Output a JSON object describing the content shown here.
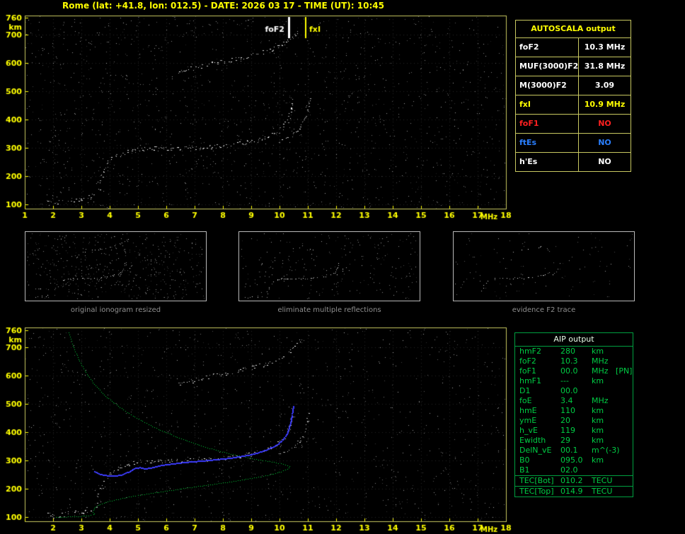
{
  "title": "Rome (lat: +41.8, lon: 012.5) - DATE: 2026 03 17 - TIME (UT): 10:45",
  "colors": {
    "accent_yellow": "#ffff00",
    "frame_yellow": "#c8c860",
    "green": "#00cc44",
    "blue": "#3c3cff",
    "red": "#ff2020",
    "table_blue": "#2a7fff",
    "white": "#ffffff",
    "caption_gray": "#8f8f8f"
  },
  "autoscala": {
    "header": "AUTOSCALA output",
    "rows": [
      {
        "param": "foF2",
        "value": "10.3 MHz",
        "color": "#ffffff"
      },
      {
        "param": "MUF(3000)F2",
        "value": "31.8 MHz",
        "color": "#ffffff"
      },
      {
        "param": "M(3000)F2",
        "value": "3.09",
        "color": "#ffffff"
      },
      {
        "param": "fxI",
        "value": "10.9 MHz",
        "color": "#ffff00"
      },
      {
        "param": "foF1",
        "value": "NO",
        "color": "#ff2020"
      },
      {
        "param": "ftEs",
        "value": "NO",
        "color": "#2a7fff"
      },
      {
        "param": "h'Es",
        "value": "NO",
        "color": "#ffffff"
      }
    ]
  },
  "thumbnails": [
    {
      "caption": "original ionogram resized"
    },
    {
      "caption": "eliminate multiple reflections"
    },
    {
      "caption": "evidence F2 trace"
    }
  ],
  "aip": {
    "header": "AIP output",
    "rows": [
      {
        "param": "hmF2",
        "value": "280",
        "unit": "km"
      },
      {
        "param": "foF2",
        "value": "10.3",
        "unit": "MHz"
      },
      {
        "param": "foF1",
        "value": "00.0",
        "unit": "MHz   [PN]"
      },
      {
        "param": "hmF1",
        "value": "---",
        "unit": "km"
      },
      {
        "param": "D1",
        "value": "00.0",
        "unit": ""
      },
      {
        "param": "foE",
        "value": "3.4",
        "unit": "MHz"
      },
      {
        "param": "hmE",
        "value": "110",
        "unit": "km"
      },
      {
        "param": "ymE",
        "value": "20",
        "unit": "km"
      },
      {
        "param": "h_vE",
        "value": "119",
        "unit": "km"
      },
      {
        "param": "Ewidth",
        "value": "29",
        "unit": "km"
      },
      {
        "param": "DelN_vE",
        "value": "00.1",
        "unit": "m^(-3)"
      },
      {
        "param": "B0",
        "value": "095.0",
        "unit": "km"
      },
      {
        "param": "B1",
        "value": "02.0",
        "unit": ""
      },
      {
        "param": "TEC[Bot]",
        "value": "010.2",
        "unit": "TECU"
      },
      {
        "param": "TEC[Top]",
        "value": "014.9",
        "unit": "TECU"
      }
    ]
  },
  "chart_data": {
    "type": "scatter",
    "title": "Autoscaled ionogram, Rome, 2026-03-17 10:45 UT",
    "xlabel": "MHz",
    "ylabel": "km",
    "xlim": [
      1,
      18
    ],
    "ylim": [
      85,
      770
    ],
    "y_ticks": [
      760,
      700,
      600,
      500,
      400,
      300,
      200,
      100
    ],
    "x_end_label": "18",
    "frame_color": "#c8c860",
    "tick_color": "#ffff00",
    "grid": "dotted",
    "plots": [
      {
        "id": "top",
        "x_tick_labels": [
          "1",
          "2",
          "3",
          "4",
          "5",
          "6",
          "7",
          "8",
          "9",
          "10",
          "11",
          "12",
          "13",
          "14",
          "15",
          "16",
          "17"
        ],
        "markers": [
          {
            "x": 10.3,
            "label": "foF2",
            "color": "#ffffff",
            "side": "left",
            "w": 3
          },
          {
            "x": 10.9,
            "label": "fxI",
            "color": "#ffff00",
            "side": "right",
            "w": 2
          }
        ]
      },
      {
        "id": "bottom",
        "x_tick_labels": [
          "",
          "2",
          "3",
          "4",
          "5",
          "6",
          "7",
          "8",
          "9",
          "10",
          "11",
          "12",
          "13",
          "14",
          "15",
          "16",
          "17"
        ],
        "markers": []
      }
    ],
    "traces": {
      "f2_ordinary": [
        [
          3.55,
          170
        ],
        [
          3.7,
          195
        ],
        [
          3.8,
          220
        ],
        [
          3.95,
          245
        ],
        [
          4.15,
          264
        ],
        [
          4.4,
          278
        ],
        [
          4.7,
          289
        ],
        [
          5.0,
          295
        ],
        [
          5.4,
          297
        ],
        [
          5.9,
          296
        ],
        [
          6.4,
          297
        ],
        [
          6.9,
          300
        ],
        [
          7.4,
          302
        ],
        [
          7.9,
          306
        ],
        [
          8.4,
          311
        ],
        [
          8.9,
          320
        ],
        [
          9.3,
          330
        ],
        [
          9.65,
          342
        ],
        [
          9.9,
          355
        ],
        [
          10.1,
          372
        ],
        [
          10.25,
          392
        ],
        [
          10.35,
          415
        ],
        [
          10.42,
          445
        ],
        [
          10.48,
          478
        ]
      ],
      "f2_extraordinary": [
        [
          9.95,
          322
        ],
        [
          10.25,
          333
        ],
        [
          10.5,
          349
        ],
        [
          10.7,
          368
        ],
        [
          10.85,
          392
        ],
        [
          10.95,
          420
        ],
        [
          11.02,
          452
        ],
        [
          11.06,
          480
        ]
      ],
      "second_hop": [
        [
          6.4,
          568
        ],
        [
          6.9,
          582
        ],
        [
          7.45,
          595
        ],
        [
          8.0,
          606
        ],
        [
          8.5,
          616
        ],
        [
          9.0,
          627
        ],
        [
          9.4,
          638
        ],
        [
          9.75,
          650
        ],
        [
          10.05,
          663
        ],
        [
          10.3,
          678
        ],
        [
          10.5,
          694
        ],
        [
          10.68,
          712
        ],
        [
          10.8,
          728
        ]
      ],
      "e_region": [
        [
          1.75,
          103
        ],
        [
          2.1,
          107
        ],
        [
          2.45,
          110
        ],
        [
          2.8,
          113
        ],
        [
          3.1,
          119
        ],
        [
          3.35,
          128
        ],
        [
          3.55,
          142
        ],
        [
          3.65,
          158
        ]
      ]
    },
    "curves": {
      "profile_green": [
        [
          2.55,
          752
        ],
        [
          2.7,
          706
        ],
        [
          2.9,
          658
        ],
        [
          3.15,
          612
        ],
        [
          3.45,
          570
        ],
        [
          3.85,
          528
        ],
        [
          4.35,
          488
        ],
        [
          4.95,
          450
        ],
        [
          5.65,
          414
        ],
        [
          6.45,
          380
        ],
        [
          7.3,
          350
        ],
        [
          8.2,
          325
        ],
        [
          9.1,
          306
        ],
        [
          9.8,
          294
        ],
        [
          10.2,
          286
        ],
        [
          10.35,
          280
        ],
        [
          10.28,
          271
        ],
        [
          10.05,
          261
        ],
        [
          9.65,
          250
        ],
        [
          9.1,
          239
        ],
        [
          8.45,
          228
        ],
        [
          7.7,
          217
        ],
        [
          6.9,
          206
        ],
        [
          6.1,
          194
        ],
        [
          5.3,
          182
        ],
        [
          4.6,
          170
        ],
        [
          4.0,
          157
        ],
        [
          3.65,
          146
        ],
        [
          3.48,
          135
        ],
        [
          3.42,
          125
        ],
        [
          3.4,
          118
        ],
        [
          3.44,
          113
        ],
        [
          3.42,
          110
        ],
        [
          3.25,
          106
        ],
        [
          2.9,
          103
        ],
        [
          2.45,
          101
        ],
        [
          2.1,
          100
        ]
      ],
      "restored_blue": [
        [
          3.45,
          262
        ],
        [
          3.65,
          253
        ],
        [
          3.9,
          248
        ],
        [
          4.15,
          247
        ],
        [
          4.4,
          251
        ],
        [
          4.65,
          261
        ],
        [
          4.85,
          273
        ],
        [
          5.05,
          277
        ],
        [
          5.25,
          272
        ],
        [
          5.5,
          277
        ],
        [
          5.75,
          283
        ],
        [
          6.05,
          288
        ],
        [
          6.45,
          293
        ],
        [
          6.85,
          297
        ],
        [
          7.25,
          300
        ],
        [
          7.65,
          304
        ],
        [
          8.05,
          308
        ],
        [
          8.45,
          313
        ],
        [
          8.85,
          320
        ],
        [
          9.25,
          330
        ],
        [
          9.6,
          342
        ],
        [
          9.9,
          357
        ],
        [
          10.1,
          374
        ],
        [
          10.25,
          396
        ],
        [
          10.35,
          424
        ],
        [
          10.42,
          456
        ],
        [
          10.47,
          492
        ]
      ]
    }
  }
}
